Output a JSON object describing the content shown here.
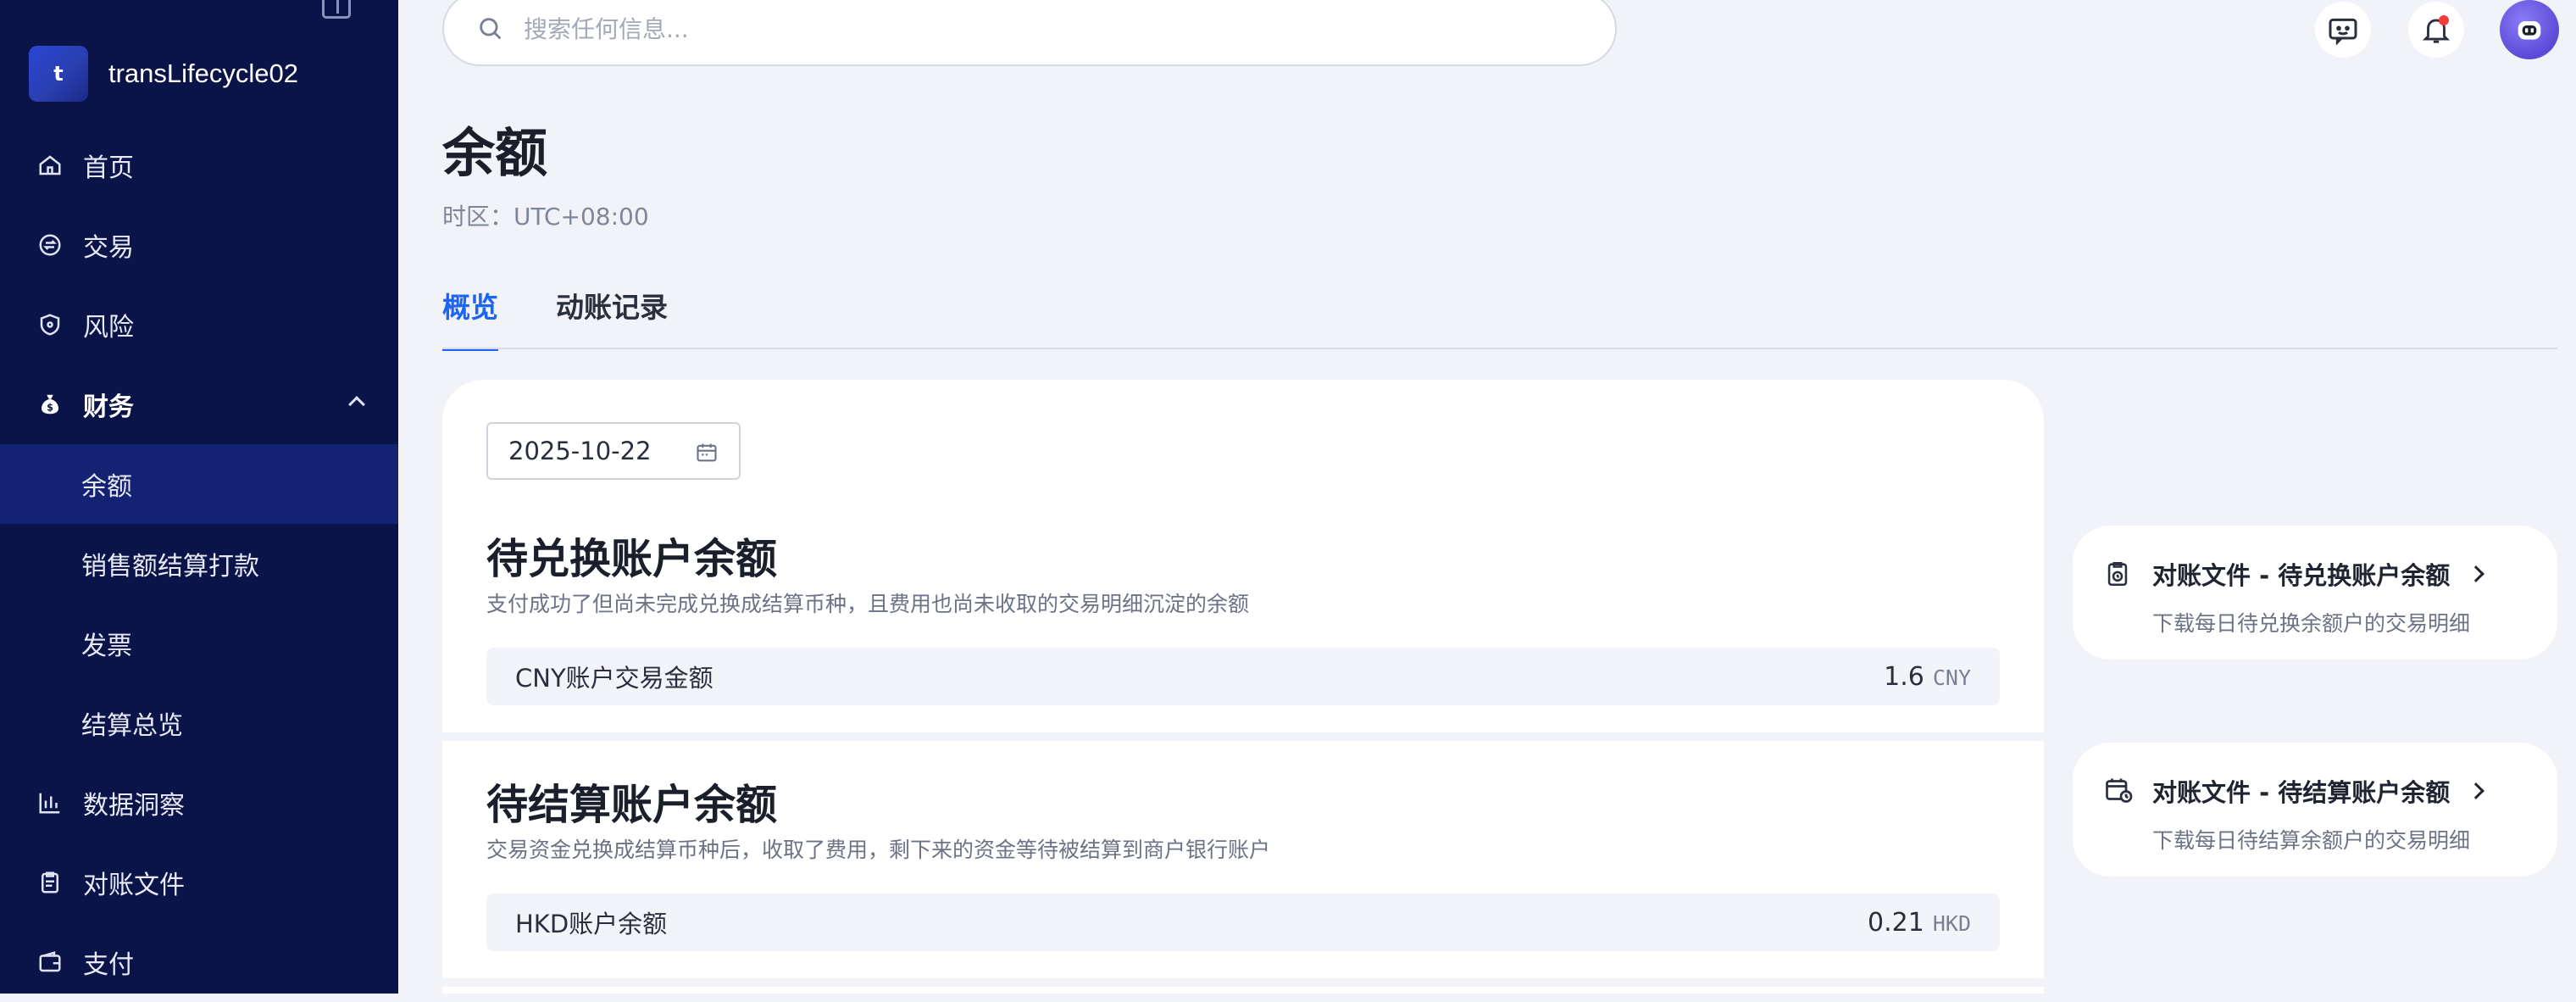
{
  "brand": {
    "logo_letter": "t",
    "name": "transLifecycle02"
  },
  "nav": {
    "items": [
      {
        "label": "首页",
        "icon": "home-icon"
      },
      {
        "label": "交易",
        "icon": "exchange-icon"
      },
      {
        "label": "风险",
        "icon": "shield-icon"
      },
      {
        "label": "财务",
        "icon": "money-bag-icon"
      },
      {
        "label": "余额"
      },
      {
        "label": "销售额结算打款"
      },
      {
        "label": "发票"
      },
      {
        "label": "结算总览"
      },
      {
        "label": "数据洞察",
        "icon": "bar-chart-icon"
      },
      {
        "label": "对账文件",
        "icon": "document-icon"
      },
      {
        "label": "支付",
        "icon": "wallet-icon"
      }
    ]
  },
  "search": {
    "placeholder": "搜索任何信息..."
  },
  "page": {
    "title": "余额",
    "timezone": "时区：UTC+08:00"
  },
  "tabs": [
    {
      "label": "概览"
    },
    {
      "label": "动账记录"
    }
  ],
  "overview": {
    "date": "2025-10-22",
    "sections": [
      {
        "title": "待兑换账户余额",
        "desc": "支付成功了但尚未完成兑换成结算币种，且费用也尚未收取的交易明细沉淀的余额",
        "row": {
          "label": "CNY账户交易金额",
          "value": "1.6",
          "currency": "CNY"
        }
      },
      {
        "title": "待结算账户余额",
        "desc": "交易资金兑换成结算币种后，收取了费用，剩下来的资金等待被结算到商户银行账户",
        "row": {
          "label": "HKD账户余额",
          "value": "0.21",
          "currency": "HKD"
        }
      }
    ]
  },
  "side_cards": [
    {
      "title": "对账文件 - 待兑换账户余额",
      "sub": "下载每日待兑换余额户的交易明细",
      "icon": "clipboard-clock-icon"
    },
    {
      "title": "对账文件 - 待结算账户余额",
      "sub": "下载每日待结算余额户的交易明细",
      "icon": "calendar-clock-icon"
    }
  ],
  "colors": {
    "sidebar_bg": "#0b1448",
    "sidebar_active": "#132273",
    "accent": "#1c64f2",
    "page_bg": "#f1f3f8"
  }
}
